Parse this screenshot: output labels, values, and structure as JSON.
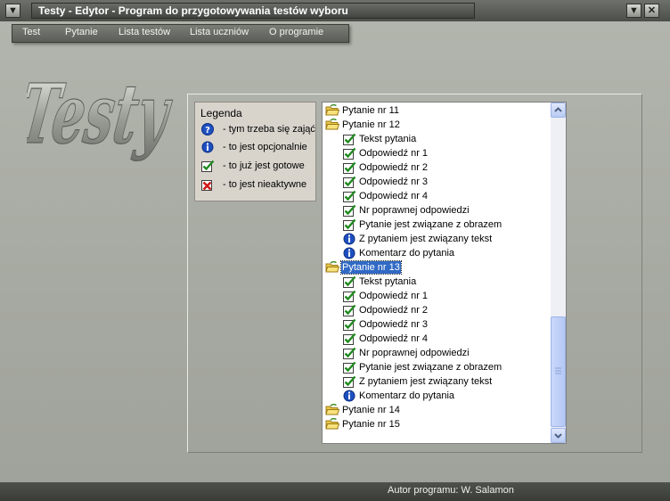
{
  "window": {
    "title": "Testy - Edytor - Program do przygotowywania testów wyboru",
    "menu_icon": "chevron-down-icon",
    "minimize_icon": "chevron-down-icon",
    "close_icon": "close-icon"
  },
  "menu": {
    "items": [
      "Test",
      "Pytanie",
      "Lista testów",
      "Lista uczniów",
      "O programie"
    ]
  },
  "logo": {
    "text": "Testy"
  },
  "legend": {
    "title": "Legenda",
    "items": [
      {
        "icon": "question-icon",
        "text": "- tym trzeba się zająć"
      },
      {
        "icon": "info-icon",
        "text": "- to jest opcjonalnie"
      },
      {
        "icon": "check-icon",
        "text": "- to już jest gotowe"
      },
      {
        "icon": "cross-icon",
        "text": "- to jest nieaktywne"
      }
    ]
  },
  "tree": {
    "items": [
      {
        "level": 0,
        "icon": "folder-icon",
        "label": "Pytanie nr 11"
      },
      {
        "level": 0,
        "icon": "folder-icon",
        "label": "Pytanie nr 12"
      },
      {
        "level": 1,
        "icon": "check-icon",
        "label": "Tekst pytania"
      },
      {
        "level": 1,
        "icon": "check-icon",
        "label": "Odpowiedź nr 1"
      },
      {
        "level": 1,
        "icon": "check-icon",
        "label": "Odpowiedź nr 2"
      },
      {
        "level": 1,
        "icon": "check-icon",
        "label": "Odpowiedź nr 3"
      },
      {
        "level": 1,
        "icon": "check-icon",
        "label": "Odpowiedź nr 4"
      },
      {
        "level": 1,
        "icon": "check-icon",
        "label": "Nr poprawnej odpowiedzi"
      },
      {
        "level": 1,
        "icon": "check-icon",
        "label": "Pytanie jest związane z obrazem"
      },
      {
        "level": 1,
        "icon": "info-icon",
        "label": "Z pytaniem jest związany tekst"
      },
      {
        "level": 1,
        "icon": "info-icon",
        "label": "Komentarz do pytania"
      },
      {
        "level": 0,
        "icon": "folder-icon",
        "label": "Pytanie nr 13",
        "selected": true
      },
      {
        "level": 1,
        "icon": "check-icon",
        "label": "Tekst pytania"
      },
      {
        "level": 1,
        "icon": "check-icon",
        "label": "Odpowiedź nr 1"
      },
      {
        "level": 1,
        "icon": "check-icon",
        "label": "Odpowiedź nr 2"
      },
      {
        "level": 1,
        "icon": "check-icon",
        "label": "Odpowiedź nr 3"
      },
      {
        "level": 1,
        "icon": "check-icon",
        "label": "Odpowiedź nr 4"
      },
      {
        "level": 1,
        "icon": "check-icon",
        "label": "Nr poprawnej odpowiedzi"
      },
      {
        "level": 1,
        "icon": "check-icon",
        "label": "Pytanie jest związane z obrazem"
      },
      {
        "level": 1,
        "icon": "check-icon",
        "label": "Z pytaniem jest związany tekst"
      },
      {
        "level": 1,
        "icon": "info-icon",
        "label": "Komentarz do pytania"
      },
      {
        "level": 0,
        "icon": "folder-icon",
        "label": "Pytanie nr 14"
      },
      {
        "level": 0,
        "icon": "folder-icon",
        "label": "Pytanie nr 15"
      }
    ]
  },
  "status": {
    "text": "Autor programu: W. Salamon"
  },
  "colors": {
    "selection": "#316ac5",
    "check": "#1f8a1f",
    "info": "#1e4fc0",
    "cross": "#d01818"
  }
}
